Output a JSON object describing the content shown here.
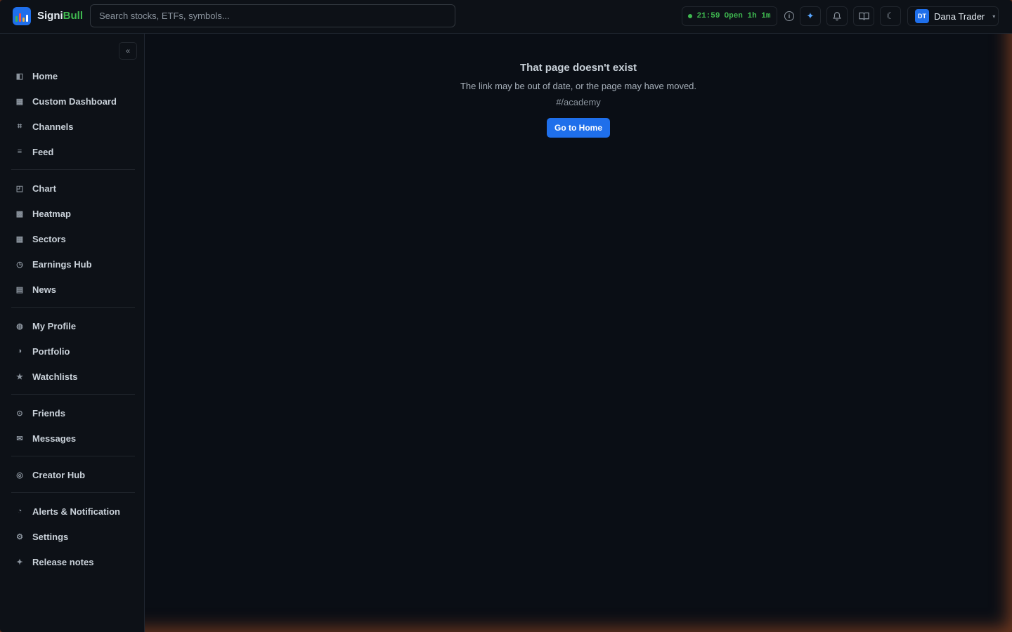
{
  "brand": {
    "part1": "Signi",
    "part2": "Bull"
  },
  "search": {
    "placeholder": "Search stocks, ETFs, symbols..."
  },
  "market": {
    "time": "21:59",
    "status": "Open 1h 1m"
  },
  "user": {
    "initials": "DT",
    "name": "Dana Trader"
  },
  "sidebar": {
    "groups": [
      [
        {
          "label": "Home",
          "icon": "home-icon"
        },
        {
          "label": "Custom Dashboard",
          "icon": "dashboard-icon"
        },
        {
          "label": "Channels",
          "icon": "hash-icon"
        },
        {
          "label": "Feed",
          "icon": "list-icon"
        }
      ],
      [
        {
          "label": "Chart",
          "icon": "chart-icon"
        },
        {
          "label": "Heatmap",
          "icon": "grid-icon"
        },
        {
          "label": "Sectors",
          "icon": "grid-icon"
        },
        {
          "label": "Earnings Hub",
          "icon": "clock-icon"
        },
        {
          "label": "News",
          "icon": "news-icon"
        }
      ],
      [
        {
          "label": "My Profile",
          "icon": "user-icon"
        },
        {
          "label": "Portfolio",
          "icon": "pie-icon"
        },
        {
          "label": "Watchlists",
          "icon": "star-icon"
        }
      ],
      [
        {
          "label": "Friends",
          "icon": "friends-icon"
        },
        {
          "label": "Messages",
          "icon": "mail-icon"
        }
      ],
      [
        {
          "label": "Creator Hub",
          "icon": "creator-icon"
        }
      ],
      [
        {
          "label": "Alerts & Notification",
          "icon": "alert-icon"
        },
        {
          "label": "Settings",
          "icon": "gear-icon"
        },
        {
          "label": "Release notes",
          "icon": "sparkle-icon"
        }
      ]
    ]
  },
  "error": {
    "title": "That page doesn't exist",
    "subtitle": "The link may be out of date, or the page may have moved.",
    "path": "#/academy",
    "button": "Go to Home"
  }
}
